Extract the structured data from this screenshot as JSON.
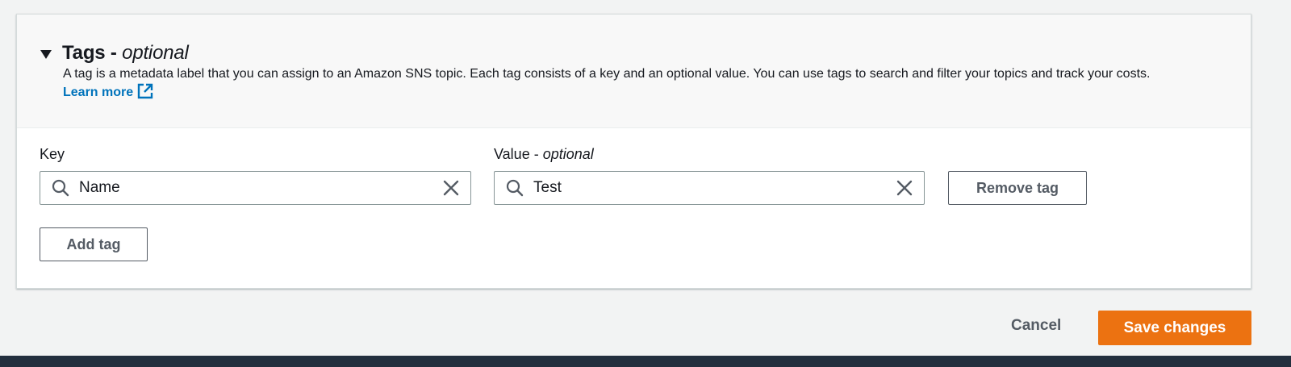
{
  "tags_panel": {
    "title": "Tags - ",
    "title_optional": "optional",
    "description": "A tag is a metadata label that you can assign to an Amazon SNS topic. Each tag consists of a key and an optional value. You can use tags to search and filter your topics and track your costs.",
    "learn_more": "Learn more",
    "expanded_icon": "caret-down-icon"
  },
  "tag_row": {
    "key_label": "Key",
    "key_value": "Name",
    "value_label": "Value - ",
    "value_label_optional": "optional",
    "value_value": "Test",
    "remove_label": "Remove tag"
  },
  "add_tag_label": "Add tag",
  "actions": {
    "cancel_label": "Cancel",
    "save_label": "Save changes"
  },
  "colors": {
    "link": "#0073bb",
    "primary": "#ec7211",
    "footer_bar": "#232f3e"
  }
}
